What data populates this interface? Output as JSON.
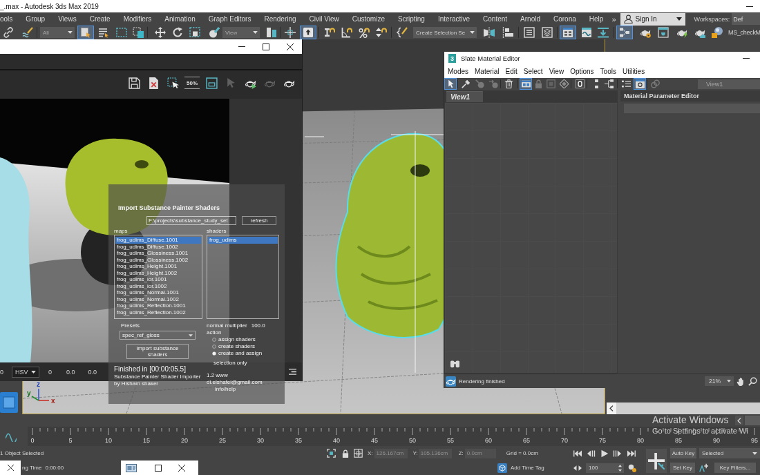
{
  "window": {
    "title": "_.max - Autodesk 3ds Max 2019"
  },
  "menu_bar": {
    "items": [
      "ools",
      "Group",
      "Views",
      "Create",
      "Modifiers",
      "Animation",
      "Graph Editors",
      "Rendering",
      "Civil View",
      "Customize",
      "Scripting",
      "Interactive",
      "Content",
      "Arnold",
      "Corona",
      "Help"
    ],
    "overflow": "»",
    "account": "Sign In",
    "workspaces_label": "Workspaces:",
    "workspace": "Def"
  },
  "main_toolbar": {
    "buttons": [
      {
        "on": false
      },
      {
        "on": false
      },
      {
        "on": true
      },
      {
        "on": false
      },
      {
        "on": false
      },
      {
        "on": false
      },
      {
        "on": false
      },
      {
        "on": false
      },
      {
        "on": false
      },
      {
        "on": false
      },
      {
        "on": false
      },
      {
        "on": false
      },
      {
        "on": true
      },
      {
        "on": false
      },
      {
        "on": false
      },
      {
        "on": false
      },
      {
        "on": false
      },
      {
        "on": false
      },
      {
        "on": false
      },
      {
        "on": false
      },
      {
        "on": false
      },
      {
        "on": false
      },
      {
        "on": true
      },
      {
        "on": false
      },
      {
        "on": false
      },
      {
        "on": true
      },
      {
        "on": false
      },
      {
        "on": false
      },
      {
        "on": false
      },
      {
        "on": false
      },
      {
        "on": false
      }
    ],
    "dropdowns": [
      "All",
      "View",
      "Create Selection Se"
    ],
    "script_button": "MS_checkM"
  },
  "viewport": {
    "axis_labels": [
      "z",
      "y",
      "x"
    ]
  },
  "render_window": {
    "toolbar": [
      {
        "disabled": false
      },
      {
        "disabled": false
      },
      {
        "disabled": false
      },
      {
        "label": "50%",
        "disabled": false
      },
      {
        "disabled": false
      },
      {
        "disabled": true
      },
      {
        "disabled": false
      },
      {
        "disabled": true
      },
      {
        "disabled": false
      }
    ],
    "channel": "0",
    "color_mode": "HSV",
    "readouts": [
      "0",
      "0.0",
      "0.0"
    ]
  },
  "import_dialog": {
    "title": "Import Substance Painter Shaders",
    "path": "F:\\projects\\substance_study_set",
    "refresh": "refresh",
    "maps_label": "maps",
    "maps": [
      {
        "name": "frog_udims_Diffuse.1001",
        "selected": true
      },
      {
        "name": "frog_udims_Diffuse.1002",
        "selected": false
      },
      {
        "name": "frog_udims_Glossiness.1001",
        "selected": false
      },
      {
        "name": "frog_udims_Glossiness.1002",
        "selected": false
      },
      {
        "name": "frog_udims_Height.1001",
        "selected": false
      },
      {
        "name": "frog_udims_Height.1002",
        "selected": false
      },
      {
        "name": "frog_udims_ior.1001",
        "selected": false
      },
      {
        "name": "frog_udims_ior.1002",
        "selected": false
      },
      {
        "name": "frog_udims_Normal.1001",
        "selected": false
      },
      {
        "name": "frog_udims_Normal.1002",
        "selected": false
      },
      {
        "name": "frog_udims_Reflection.1001",
        "selected": false
      },
      {
        "name": "frog_udims_Reflection.1002",
        "selected": false
      }
    ],
    "shaders_label": "shaders",
    "shaders": [
      {
        "name": "frog_udims",
        "selected": true
      }
    ],
    "presets_label": "Presets",
    "preset": "spec_ref_gloss",
    "normal_label": "normal multiplier",
    "normal_value": "100.0",
    "action_label": "action",
    "actions": [
      {
        "label": "assign shaders",
        "selected": false
      },
      {
        "label": "create shaders",
        "selected": false
      },
      {
        "label": "create and assign",
        "selected": true
      }
    ],
    "import_button": "import substance shaders",
    "selection_only": "selection only",
    "status": "Finished in [00:00:05.5]",
    "credits": [
      "Substance Painter Shader Importer",
      "by Hisham shaker"
    ],
    "contact": "1.2 www di.elshafei@gmail.com",
    "help": "info/help"
  },
  "slate_editor": {
    "title": "Slate Material Editor",
    "logo": "3",
    "menus": [
      "Modes",
      "Material",
      "Edit",
      "Select",
      "View",
      "Options",
      "Tools",
      "Utilities"
    ],
    "toolbar": [
      {
        "on": true,
        "disabled": false
      },
      {
        "on": false,
        "disabled": false
      },
      {
        "on": false,
        "disabled": true
      },
      {
        "on": false,
        "disabled": true
      },
      {
        "on": false,
        "disabled": false
      },
      {
        "on": true,
        "disabled": false
      },
      {
        "on": false,
        "disabled": true
      },
      {
        "on": false,
        "disabled": true
      },
      {
        "on": false,
        "disabled": false
      },
      {
        "on": false,
        "disabled": false
      },
      {
        "on": false,
        "disabled": false
      },
      {
        "on": false,
        "disabled": false
      },
      {
        "on": false,
        "disabled": false
      },
      {
        "on": true,
        "disabled": false
      },
      {
        "on": false,
        "disabled": true
      }
    ],
    "view_selector": "View1",
    "tabs": [
      {
        "label": "View1",
        "selected": true
      }
    ],
    "parameter_panel": "Material Parameter Editor",
    "status": "Rendering finished",
    "zoom": "21%"
  },
  "timeline": {
    "frames": [
      "0",
      "5",
      "10",
      "15",
      "20",
      "25",
      "30",
      "35",
      "40",
      "45",
      "50",
      "55",
      "60",
      "65",
      "70",
      "75",
      "80",
      "85",
      "90",
      "95"
    ]
  },
  "status_bar": {
    "selection": "1 Object Selected",
    "prompt": "ng Time",
    "time": "0:00:00",
    "coordinates": [
      {
        "axis": "X:",
        "value": "126.167cm"
      },
      {
        "axis": "Y:",
        "value": "105.136cm"
      },
      {
        "axis": "Z:",
        "value": "0.0cm"
      }
    ],
    "grid": "Grid = 0.0cm",
    "time_tag": "Add Time Tag",
    "frame_field": "100",
    "auto_key": "Auto Key",
    "key_mode": "Selected",
    "set_key": "Set Key",
    "key_filters": "Key Filters..."
  },
  "activation_notice": {
    "title": "Activate Windows",
    "text": "Go to Settings to activate Wi"
  }
}
